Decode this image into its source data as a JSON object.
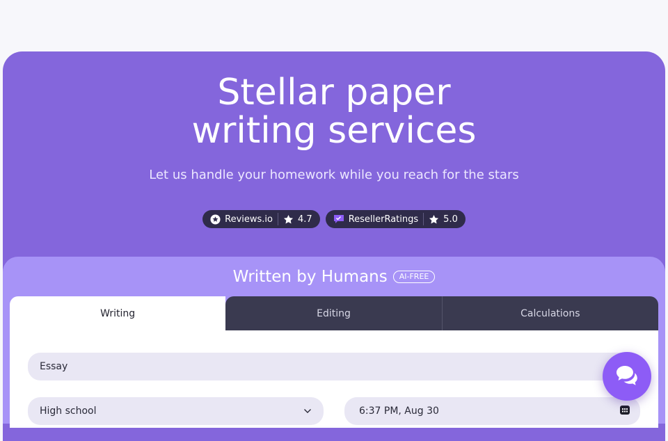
{
  "hero": {
    "title_line1": "Stellar paper",
    "title_line2": "writing services",
    "subtitle": "Let us handle your homework while you reach for the stars"
  },
  "badges": [
    {
      "platform": "Reviews.io",
      "rating": "4.7",
      "icon": "reviews-io-logo-icon"
    },
    {
      "platform": "ResellerRatings",
      "rating": "5.0",
      "icon": "resellerratings-logo-icon"
    }
  ],
  "form": {
    "heading": "Written by Humans",
    "tag": "AI-FREE",
    "tabs": [
      {
        "label": "Writing",
        "active": true
      },
      {
        "label": "Editing",
        "active": false
      },
      {
        "label": "Calculations",
        "active": false
      }
    ],
    "paper_type": "Essay",
    "academic_level": "High school",
    "deadline": "6:37 PM, Aug 30"
  },
  "colors": {
    "hero_bg": "#8466dc",
    "card_bg": "#a793f7",
    "chat_button": "#8d5cf6",
    "badge_bg": "#2f2b4a",
    "tab_inactive": "#3a3a50"
  },
  "chat": {
    "icon": "chat-bubbles-icon"
  }
}
